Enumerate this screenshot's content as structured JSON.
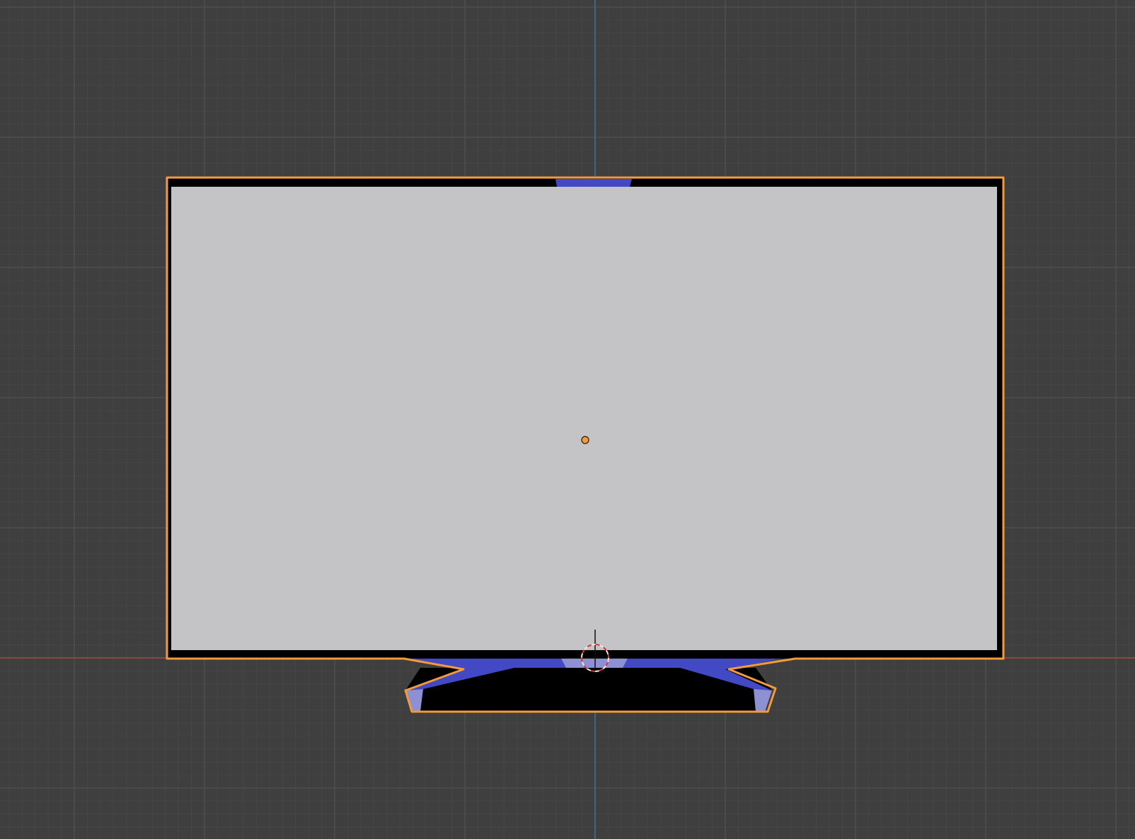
{
  "viewport": {
    "background_color": "#3f3f3f",
    "grid_minor_color": "#464646",
    "grid_major_color": "#525252",
    "axis_x_color": "#a04848",
    "axis_y_color": "#3f6f9a"
  },
  "scene_object": {
    "name_icon": "tv-mesh",
    "selection_outline_color": "#f39a3c",
    "bezel_color": "#000000",
    "screen_color": "#c4c3c5",
    "stand_color": "#4349c4",
    "stand_highlight_color": "#8e90d4",
    "origin_color": "#f39a3c",
    "selected": true
  },
  "cursor_3d": {
    "icon": "3d-cursor-icon",
    "ring_color_a": "#e8e8e8",
    "ring_color_b": "#d23a3a"
  }
}
